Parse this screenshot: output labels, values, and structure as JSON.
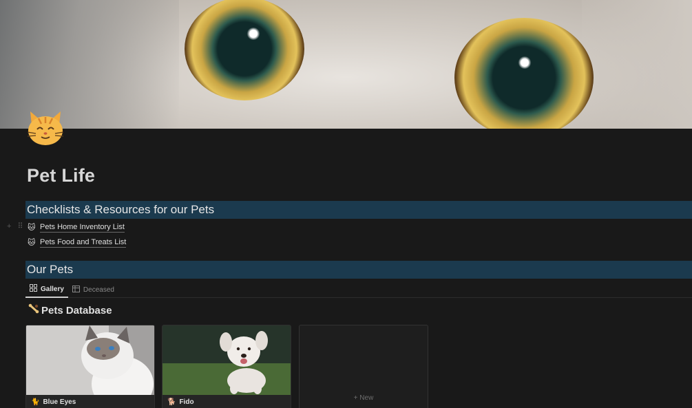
{
  "page": {
    "title": "Pet Life",
    "icon": "cat-face-icon"
  },
  "sections": [
    {
      "heading": "Checklists & Resources for our Pets",
      "links": [
        {
          "icon": "cat-face-icon",
          "label": "Pets Home Inventory List"
        },
        {
          "icon": "cat-face-icon",
          "label": "Pets Food and Treats List"
        }
      ]
    },
    {
      "heading": "Our Pets"
    }
  ],
  "database": {
    "tabs": [
      {
        "icon": "gallery-grid-icon",
        "label": "Gallery",
        "active": true
      },
      {
        "icon": "table-icon",
        "label": "Deceased",
        "active": false
      }
    ],
    "title": "Pets Database",
    "title_icon": "dog-bone-icon",
    "cards": [
      {
        "name": "Blue Eyes",
        "icon": "cat-icon"
      },
      {
        "name": "Fido",
        "icon": "dog-icon"
      }
    ],
    "new_label": "New"
  },
  "colors": {
    "background": "#191919",
    "heading_band": "#1b3a4e"
  }
}
